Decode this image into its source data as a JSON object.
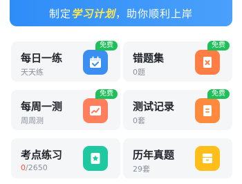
{
  "banner": {
    "prefix": "制定",
    "highlight": "学习计划",
    "suffix": "，助你顺利上岸"
  },
  "badge_label": "免费",
  "cards": [
    {
      "title": "每日一练",
      "sub": "天天练",
      "icon": "calendar-check-icon",
      "color": "#3c8ff2",
      "free": true
    },
    {
      "title": "错题集",
      "sub": "0题",
      "icon": "error-doc-icon",
      "color": "#ff7e45",
      "free": true
    },
    {
      "title": "每周一测",
      "sub": "周周测",
      "icon": "trend-chart-icon",
      "color": "#ff7f5c",
      "free": true
    },
    {
      "title": "测试记录",
      "sub": "0套",
      "icon": "record-doc-icon",
      "color": "#ff8a3d",
      "free": true
    },
    {
      "title": "考点练习",
      "sub_highlight": "0",
      "sub": "/2650",
      "icon": "star-book-icon",
      "color": "#1ec9a0",
      "free": false
    },
    {
      "title": "历年真题",
      "sub": "29套",
      "icon": "archive-box-icon",
      "color": "#ffbe1a",
      "free": false
    }
  ]
}
